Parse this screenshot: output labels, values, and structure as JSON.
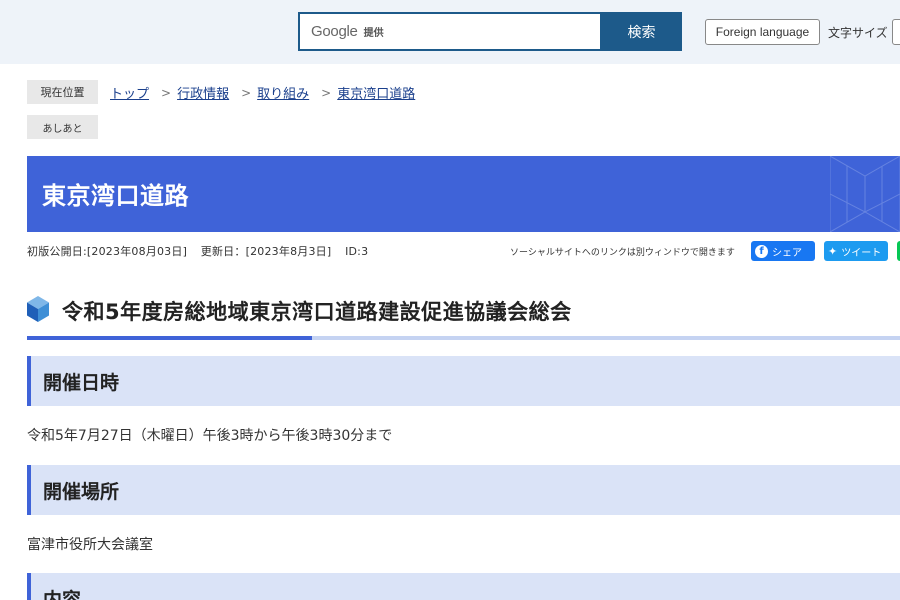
{
  "header": {
    "search_brand": "Google",
    "search_provided": "提供",
    "search_button": "検索",
    "foreign_language": "Foreign language",
    "font_size_label": "文字サイズ"
  },
  "breadcrumb": {
    "label": "現在位置",
    "items": [
      "トップ",
      "行政情報",
      "取り組み",
      "東京湾口道路"
    ],
    "ashiato": "あしあと"
  },
  "page_title": "東京湾口道路",
  "meta": {
    "published": "初版公開日:[2023年08月03日]",
    "updated": "更新日：[2023年8月3日]",
    "id": "ID:3",
    "sns_note": "ソーシャルサイトへのリンクは別ウィンドウで開きます",
    "share_facebook": "シェア",
    "share_twitter": "ツイート"
  },
  "article": {
    "heading": "令和5年度房総地域東京湾口道路建設促進協議会総会",
    "sections": [
      {
        "heading": "開催日時",
        "body": "令和5年7月27日（木曜日）午後3時から午後3時30分まで"
      },
      {
        "heading": "開催場所",
        "body": "富津市役所大会議室"
      },
      {
        "heading": "内容"
      }
    ]
  },
  "colors": {
    "header_bg": "#eef3f9",
    "search_accent": "#1d5a8a",
    "title_banner": "#3f63d8",
    "section_bg": "#dae3f7",
    "facebook": "#1877f2",
    "twitter": "#1d9bf0",
    "line": "#06c755"
  }
}
